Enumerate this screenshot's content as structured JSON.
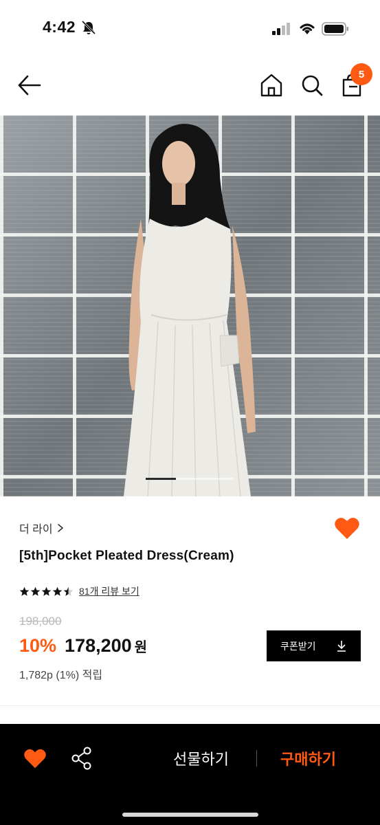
{
  "status_bar": {
    "time": "4:42"
  },
  "header": {
    "back_icon": "arrow-left-icon",
    "home_icon": "home-icon",
    "search_icon": "search-icon",
    "bag_icon": "shopping-bag-icon",
    "bag_count": "5"
  },
  "product": {
    "brand": "더 라이",
    "title": "[5th]Pocket Pleated Dress(Cream)",
    "rating": 4.5,
    "review_link": "81개 리뷰 보기",
    "original_price": "198,000",
    "discount": "10%",
    "sale_price": "178,200",
    "currency": "원",
    "points": "1,782p (1%) 적립",
    "coupon_label": "쿠폰받기",
    "image_slide": {
      "current": 1,
      "total": 3
    }
  },
  "bottom_bar": {
    "gift_label": "선물하기",
    "buy_label": "구매하기"
  },
  "colors": {
    "accent": "#ff5a14",
    "dark": "#000000"
  }
}
